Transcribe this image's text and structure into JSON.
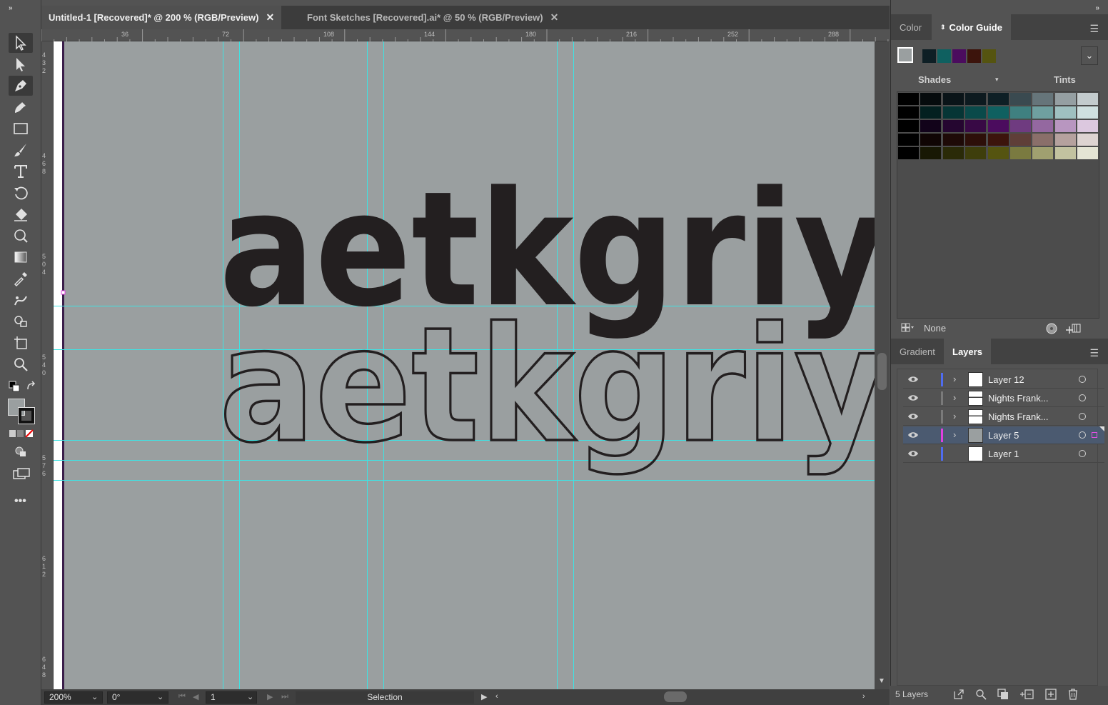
{
  "tabs": [
    {
      "label": "Untitled-1 [Recovered]* @ 200 % (RGB/Preview)",
      "close": "✕"
    },
    {
      "label": "Font Sketches [Recovered].ai* @ 50 % (RGB/Preview)",
      "close": "✕"
    }
  ],
  "ruler": {
    "h": [
      "36",
      "72",
      "108",
      "144",
      "180",
      "216",
      "252",
      "288"
    ],
    "v": [
      "432",
      "468",
      "504",
      "540",
      "576",
      "612",
      "648"
    ]
  },
  "artwork": {
    "filled_text": "aetkgriy",
    "outline_text": "aetkgriy",
    "fill_color": "#231f20",
    "canvas_color": "#9a9fa0",
    "guide_color": "#27e6e6"
  },
  "status": {
    "zoom": "200%",
    "rotation": "0°",
    "artboard": "1",
    "tool": "Selection"
  },
  "color_panel": {
    "tabs": [
      "Color",
      "Color Guide"
    ],
    "active_tab": "Color Guide",
    "harmony": [
      "#0e1f25",
      "#0f6060",
      "#4b0c5e",
      "#3c140c",
      "#555410"
    ],
    "shades_label": "Shades",
    "tints_label": "Tints",
    "none_label": "None",
    "grid": [
      [
        "#000000",
        "#060b0d",
        "#0a1418",
        "#0d1a1f",
        "#0e1f25",
        "#3a4a50",
        "#66757a",
        "#959fa2",
        "#c3cbcd"
      ],
      [
        "#000000",
        "#032020",
        "#063535",
        "#0a4a4a",
        "#0f6060",
        "#3f8080",
        "#6fa0a0",
        "#9fc0c0",
        "#cfe0e0"
      ],
      [
        "#000000",
        "#12031a",
        "#250630",
        "#380945",
        "#4b0c5e",
        "#6f3b80",
        "#9468a0",
        "#b896c0",
        "#dcc8df"
      ],
      [
        "#000000",
        "#100504",
        "#1e0a07",
        "#2d0f09",
        "#3c140c",
        "#5f3e38",
        "#8a6f6a",
        "#b5a19e",
        "#ddd3d1"
      ],
      [
        "#000000",
        "#181804",
        "#2a2a08",
        "#3e3e0c",
        "#555410",
        "#7a7a40",
        "#a0a070",
        "#c2c2a0",
        "#e4e4d4"
      ]
    ]
  },
  "layers_panel": {
    "tabs": [
      "Gradient",
      "Layers"
    ],
    "active_tab": "Layers",
    "layers": [
      {
        "name": "Layer 12",
        "color": "#4f6cf0",
        "selected": false,
        "expandable": true,
        "thumb": "white"
      },
      {
        "name": "Nights Frank...",
        "color": "#7a7a7a",
        "selected": false,
        "expandable": true,
        "thumb": "sketch"
      },
      {
        "name": "Nights Frank...",
        "color": "#7a7a7a",
        "selected": false,
        "expandable": true,
        "thumb": "sketch"
      },
      {
        "name": "Layer 5",
        "color": "#e040e0",
        "selected": true,
        "expandable": true,
        "thumb": "gray"
      },
      {
        "name": "Layer 1",
        "color": "#4f6cf0",
        "selected": false,
        "expandable": false,
        "thumb": "white"
      }
    ],
    "count_label": "5 Layers"
  }
}
